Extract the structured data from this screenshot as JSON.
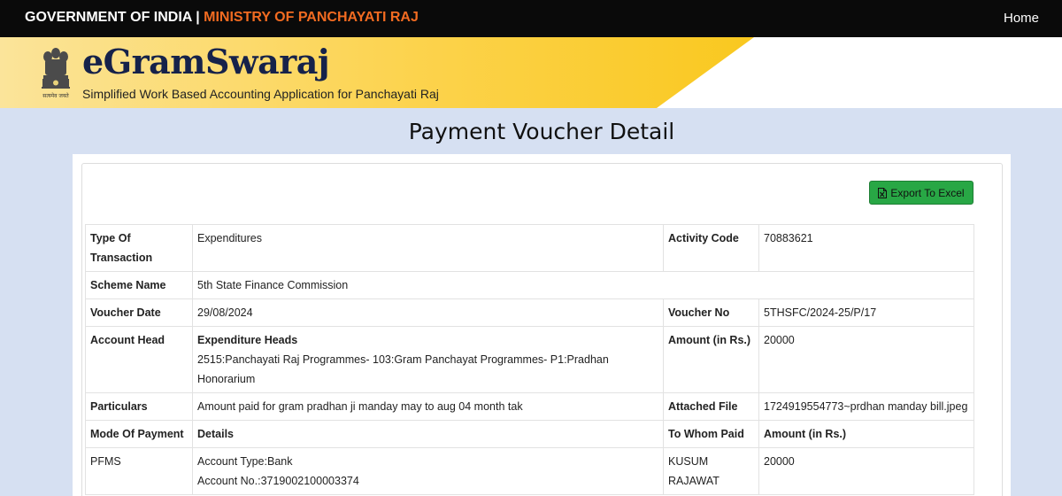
{
  "topbar": {
    "gov_label": "GOVERNMENT OF INDIA",
    "separator": "|",
    "ministry_label": "MINISTRY OF PANCHAYATI RAJ",
    "home_link": "Home"
  },
  "banner": {
    "brand": "eGramSwaraj",
    "tagline": "Simplified Work Based Accounting Application for Panchayati Raj",
    "emblem_caption": "सत्यमेव जयते"
  },
  "page_title": "Payment Voucher Detail",
  "export_button": {
    "label": "Export To Excel",
    "icon": "excel-file-icon"
  },
  "colors": {
    "topbar": "#0a0a0a",
    "ministry": "#f26b21",
    "banner_yellow": "#fcd34d",
    "page_bg": "#d6e0f2",
    "button": "#28a745"
  },
  "voucher": {
    "type_label": "Type Of Transaction",
    "type_value": "Expenditures",
    "activity_label": "Activity Code",
    "activity_value": "70883621",
    "scheme_label": "Scheme Name",
    "scheme_value": "5th State Finance Commission",
    "date_label": "Voucher Date",
    "date_value": "29/08/2024",
    "voucher_no_label": "Voucher No",
    "voucher_no_value": "5THSFC/2024-25/P/17",
    "account_head_label": "Account Head",
    "expenditure_heads_label": "Expenditure Heads",
    "expenditure_heads_value": "2515:Panchayati Raj Programmes- 103:Gram Panchayat Programmes- P1:Pradhan Honorarium",
    "amount_label": "Amount (in Rs.)",
    "amount_value": "20000",
    "particulars_label": "Particulars",
    "particulars_value": "Amount paid for gram pradhan ji manday may to aug 04 month tak",
    "attached_label": "Attached File",
    "attached_value": "1724919554773~prdhan manday bill.jpeg"
  },
  "payment": {
    "headers": {
      "mode": "Mode Of Payment",
      "details": "Details",
      "to_whom": "To Whom Paid",
      "amount": "Amount (in Rs.)"
    },
    "rows": [
      {
        "mode": "PFMS",
        "account_type": "Account Type:Bank",
        "account_no": "Account No.:3719002100003374",
        "to_whom": "KUSUM RAJAWAT",
        "amount": "20000"
      }
    ]
  }
}
